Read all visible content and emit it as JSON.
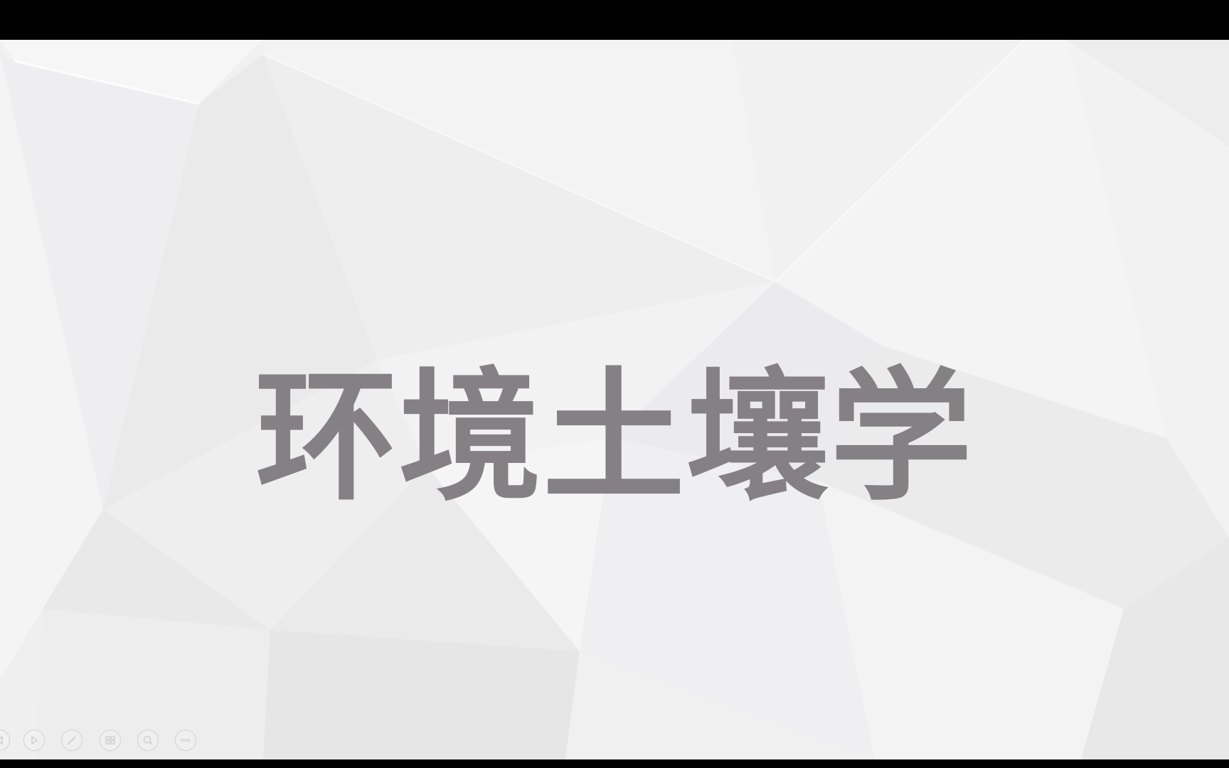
{
  "slide": {
    "title": "环境土壤学"
  },
  "toolbar": {
    "buttons": [
      {
        "icon": "previous-slide-icon"
      },
      {
        "icon": "next-slide-icon"
      },
      {
        "icon": "pen-icon"
      },
      {
        "icon": "slide-sorter-icon"
      },
      {
        "icon": "zoom-icon"
      },
      {
        "icon": "more-options-icon"
      }
    ]
  },
  "colors": {
    "title": "#848084",
    "background": "#f1f0f1",
    "frame": "#000000"
  }
}
